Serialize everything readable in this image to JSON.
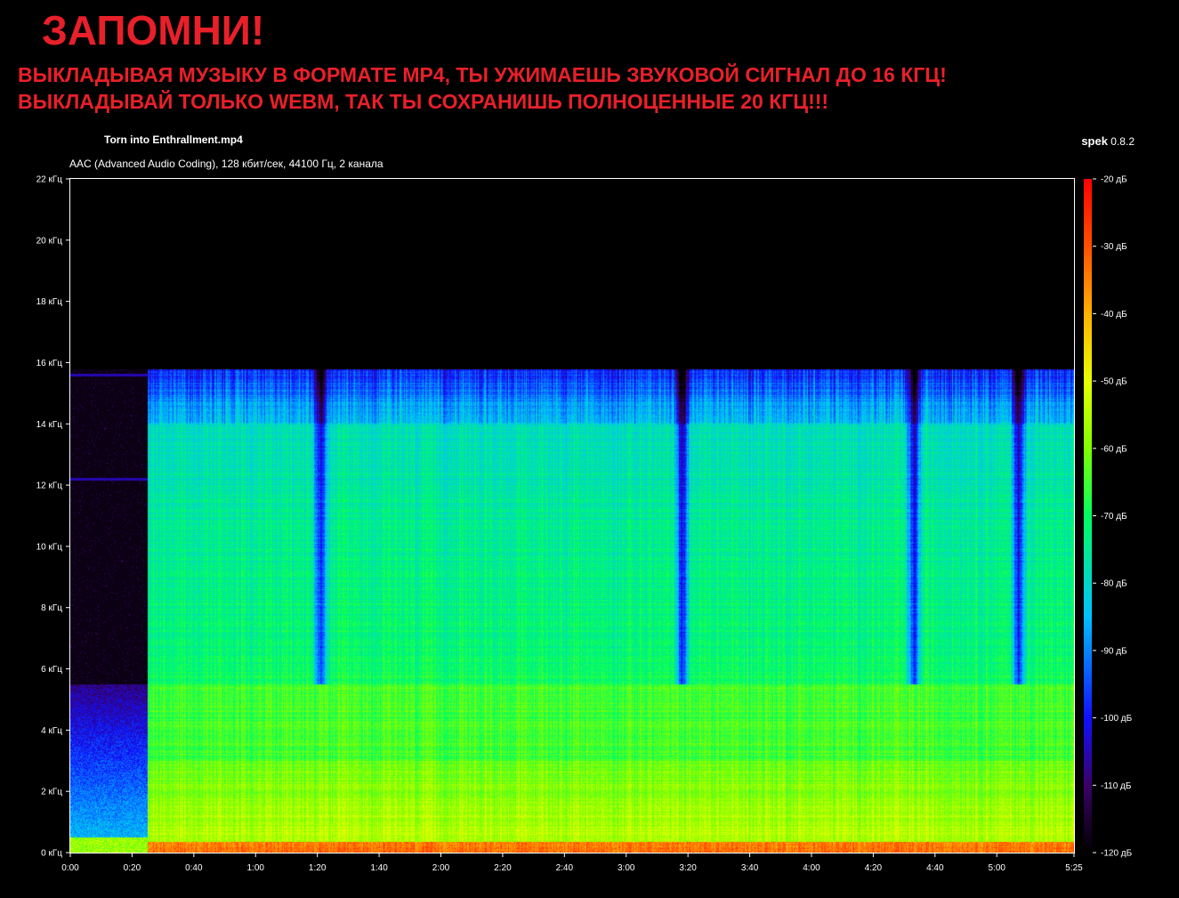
{
  "header": {
    "title": "ЗАПОМНИ!",
    "line1": "ВЫКЛАДЫВАЯ МУЗЫКУ В ФОРМАТЕ MP4, ТЫ УЖИМАЕШЬ ЗВУКОВОЙ СИГНАЛ ДО 16 КГЦ!",
    "line2": "ВЫКЛАДЫВАЙ ТОЛЬКО WEBM, ТАК ТЫ СОХРАНИШЬ ПОЛНОЦЕННЫЕ 20 КГЦ!!!"
  },
  "file": {
    "name": "Torn into Enthrallment.mp4",
    "codec_info": "AAC (Advanced Audio Coding), 128 кбит/сек, 44100 Гц, 2 канала"
  },
  "app": {
    "name": "spek",
    "version": "0.8.2"
  },
  "colors": {
    "headline": "#e8202a",
    "spectrum_low": "#000000",
    "spectrum_mid": "#00ff40",
    "spectrum_high": "#ff1010"
  },
  "chart_data": {
    "type": "heatmap",
    "x_ticks": [
      "0:00",
      "0:20",
      "0:40",
      "1:00",
      "1:20",
      "1:40",
      "2:00",
      "2:20",
      "2:40",
      "3:00",
      "3:20",
      "3:40",
      "4:00",
      "4:20",
      "4:40",
      "5:00",
      "5:25"
    ],
    "x_tick_seconds": [
      0,
      20,
      40,
      60,
      80,
      100,
      120,
      140,
      160,
      180,
      200,
      220,
      240,
      260,
      280,
      300,
      325
    ],
    "xlim": [
      0,
      325
    ],
    "y_ticks": [
      "0 кГц",
      "2 кГц",
      "4 кГц",
      "6 кГц",
      "8 кГц",
      "10 кГц",
      "12 кГц",
      "14 кГц",
      "16 кГц",
      "18 кГц",
      "20 кГц",
      "22 кГц"
    ],
    "y_tick_khz": [
      0,
      2,
      4,
      6,
      8,
      10,
      12,
      14,
      16,
      18,
      20,
      22
    ],
    "ylim": [
      0,
      22
    ],
    "colorbar_ticks": [
      "-20 дБ",
      "-30 дБ",
      "-40 дБ",
      "-50 дБ",
      "-60 дБ",
      "-70 дБ",
      "-80 дБ",
      "-90 дБ",
      "-100 дБ",
      "-110 дБ",
      "-120 дБ"
    ],
    "colorbar_db": [
      -20,
      -30,
      -40,
      -50,
      -60,
      -70,
      -80,
      -90,
      -100,
      -110,
      -120
    ],
    "colorbar_range": [
      -120,
      -20
    ],
    "cutoff_khz": 15.8,
    "quiet_intro_end_s": 25,
    "dips_s": [
      81,
      198,
      273,
      307
    ],
    "grid": false
  }
}
